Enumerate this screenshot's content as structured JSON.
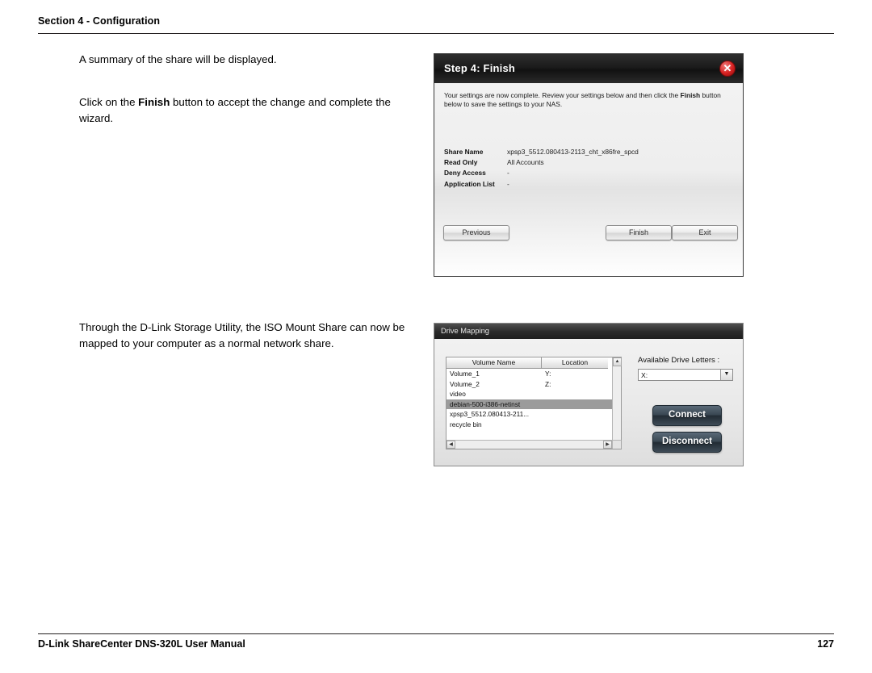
{
  "header": {
    "section": "Section 4 - Configuration"
  },
  "footer": {
    "left": "D-Link ShareCenter DNS-320L User Manual",
    "page": "127"
  },
  "body": {
    "para1": "A summary of the share will be displayed.",
    "para2_before": "Click on the ",
    "para2_bold": "Finish",
    "para2_after": " button to accept the change and complete the wizard.",
    "para3": "Through the D-Link Storage Utility, the ISO Mount Share can now be mapped to your computer as a normal network share."
  },
  "wizard": {
    "title": "Step 4: Finish",
    "close_icon": "close-icon",
    "description_before": "Your settings are now complete. Review your settings below and then click the ",
    "description_bold": "Finish",
    "description_after": " button below to save the settings to your NAS.",
    "fields": [
      {
        "label": "Share Name",
        "value": "xpsp3_5512.080413-2113_cht_x86fre_spcd"
      },
      {
        "label": "Read Only",
        "value": "All Accounts"
      },
      {
        "label": "Deny Access",
        "value": "-"
      },
      {
        "label": "Application List",
        "value": "-"
      }
    ],
    "buttons": {
      "previous": "Previous",
      "finish": "Finish",
      "exit": "Exit"
    }
  },
  "drive_mapping": {
    "title": "Drive Mapping",
    "columns": [
      "Volume Name",
      "Location"
    ],
    "rows": [
      {
        "name": "Volume_1",
        "location": "Y:",
        "selected": false
      },
      {
        "name": "Volume_2",
        "location": "Z:",
        "selected": false
      },
      {
        "name": "video",
        "location": "",
        "selected": false
      },
      {
        "name": "debian-500-i386-netinst",
        "location": "",
        "selected": true
      },
      {
        "name": "xpsp3_5512.080413-211...",
        "location": "",
        "selected": false
      },
      {
        "name": "recycle bin",
        "location": "",
        "selected": false
      }
    ],
    "drive_letters_label": "Available Drive Letters :",
    "drive_letter_selected": "X:",
    "connect_label": "Connect",
    "disconnect_label": "Disconnect",
    "scroll_up_icon": "caret-up-icon",
    "scroll_down_icon": "caret-down-icon",
    "scroll_left_icon": "caret-left-icon",
    "scroll_right_icon": "caret-right-icon",
    "dropdown_icon": "chevron-down-icon"
  }
}
